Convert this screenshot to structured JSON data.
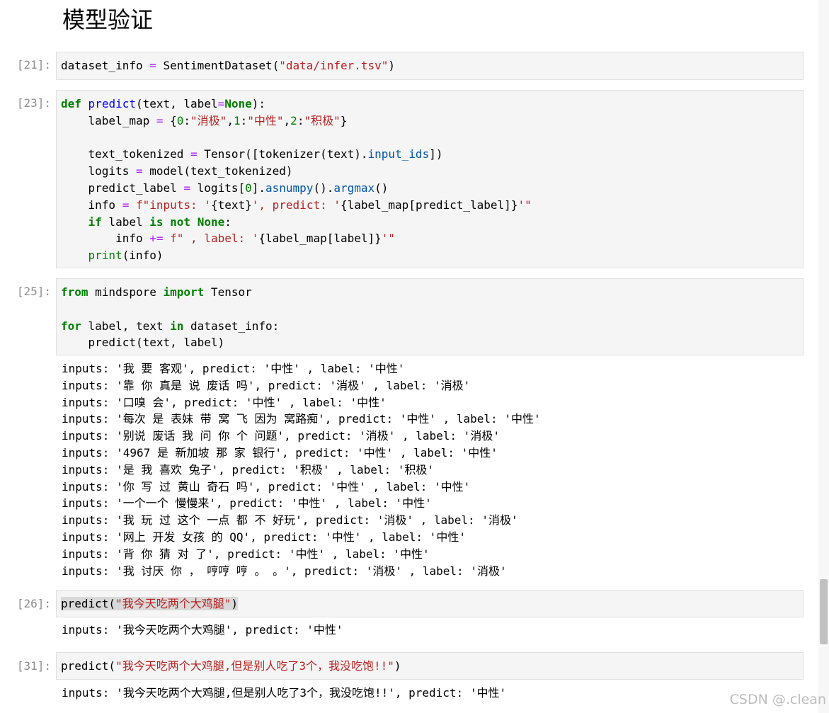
{
  "heading": "模型验证",
  "cells": [
    {
      "prompt": "[21]:"
    },
    {
      "prompt": "[23]:"
    },
    {
      "prompt": "[25]:"
    },
    {
      "prompt": "[26]:"
    },
    {
      "prompt": "[31]:"
    }
  ],
  "code": {
    "c21": [
      "dataset_info ",
      "=",
      " SentimentDataset(",
      "\"data/infer.tsv\"",
      ")"
    ],
    "c23": {
      "l1": [
        "def",
        " ",
        "predict",
        "(text, label",
        "=",
        "None",
        "):"
      ],
      "l2": [
        "    label_map ",
        "=",
        " {",
        "0",
        ":",
        "\"消极\"",
        ",",
        "1",
        ":",
        "\"中性\"",
        ",",
        "2",
        ":",
        "\"积极\"",
        "}"
      ],
      "l4": [
        "    text_tokenized ",
        "=",
        " Tensor([tokenizer(text).",
        "input_ids",
        "])"
      ],
      "l5": [
        "    logits ",
        "=",
        " model(text_tokenized)"
      ],
      "l6": [
        "    predict_label ",
        "=",
        " logits[",
        "0",
        "].",
        "asnumpy",
        "().",
        "argmax",
        "()"
      ],
      "l7": [
        "    info ",
        "=",
        " ",
        "f\"inputs: '",
        "{text}",
        "', predict: '",
        "{label_map[predict_label]}",
        "'\""
      ],
      "l8": [
        "    ",
        "if",
        " label ",
        "is",
        " ",
        "not",
        " ",
        "None",
        ":"
      ],
      "l9": [
        "        info ",
        "+=",
        " ",
        "f\" , label: '",
        "{label_map[label]}",
        "'\""
      ],
      "l10": [
        "    ",
        "print",
        "(info)"
      ]
    },
    "c25": {
      "l1": [
        "from",
        " mindspore ",
        "import",
        " Tensor"
      ],
      "l3": [
        "for",
        " label, text ",
        "in",
        " dataset_info:"
      ],
      "l4": [
        "    predict(text, label)"
      ]
    },
    "c26": [
      "predict(",
      "\"我今天吃两个大鸡腿\"",
      ")"
    ],
    "c31": [
      "predict(",
      "\"我今天吃两个大鸡腿,但是别人吃了3个，我没吃饱!!\"",
      ")"
    ]
  },
  "outputs": {
    "o25": [
      "inputs: '我 要 客观', predict: '中性' , label: '中性'",
      "inputs: '靠 你 真是 说 废话 吗', predict: '消极' , label: '消极'",
      "inputs: '口嗅 会', predict: '中性' , label: '中性'",
      "inputs: '每次 是 表妹 带 窝 飞 因为 窝路痴', predict: '中性' , label: '中性'",
      "inputs: '别说 废话 我 问 你 个 问题', predict: '消极' , label: '消极'",
      "inputs: '4967 是 新加坡 那 家 银行', predict: '中性' , label: '中性'",
      "inputs: '是 我 喜欢 兔子', predict: '积极' , label: '积极'",
      "inputs: '你 写 过 黄山 奇石 吗', predict: '中性' , label: '中性'",
      "inputs: '一个一个 慢慢来', predict: '中性' , label: '中性'",
      "inputs: '我 玩 过 这个 一点 都 不 好玩', predict: '消极' , label: '消极'",
      "inputs: '网上 开发 女孩 的 QQ', predict: '中性' , label: '中性'",
      "inputs: '背 你 猜 对 了', predict: '中性' , label: '中性'",
      "inputs: '我 讨厌 你 ， 哼哼 哼 。 。', predict: '消极' , label: '消极'"
    ],
    "o26": "inputs: '我今天吃两个大鸡腿', predict: '中性'",
    "o31": "inputs: '我今天吃两个大鸡腿,但是别人吃了3个，我没吃饱!!', predict: '中性'"
  },
  "watermark": "CSDN @.clean"
}
